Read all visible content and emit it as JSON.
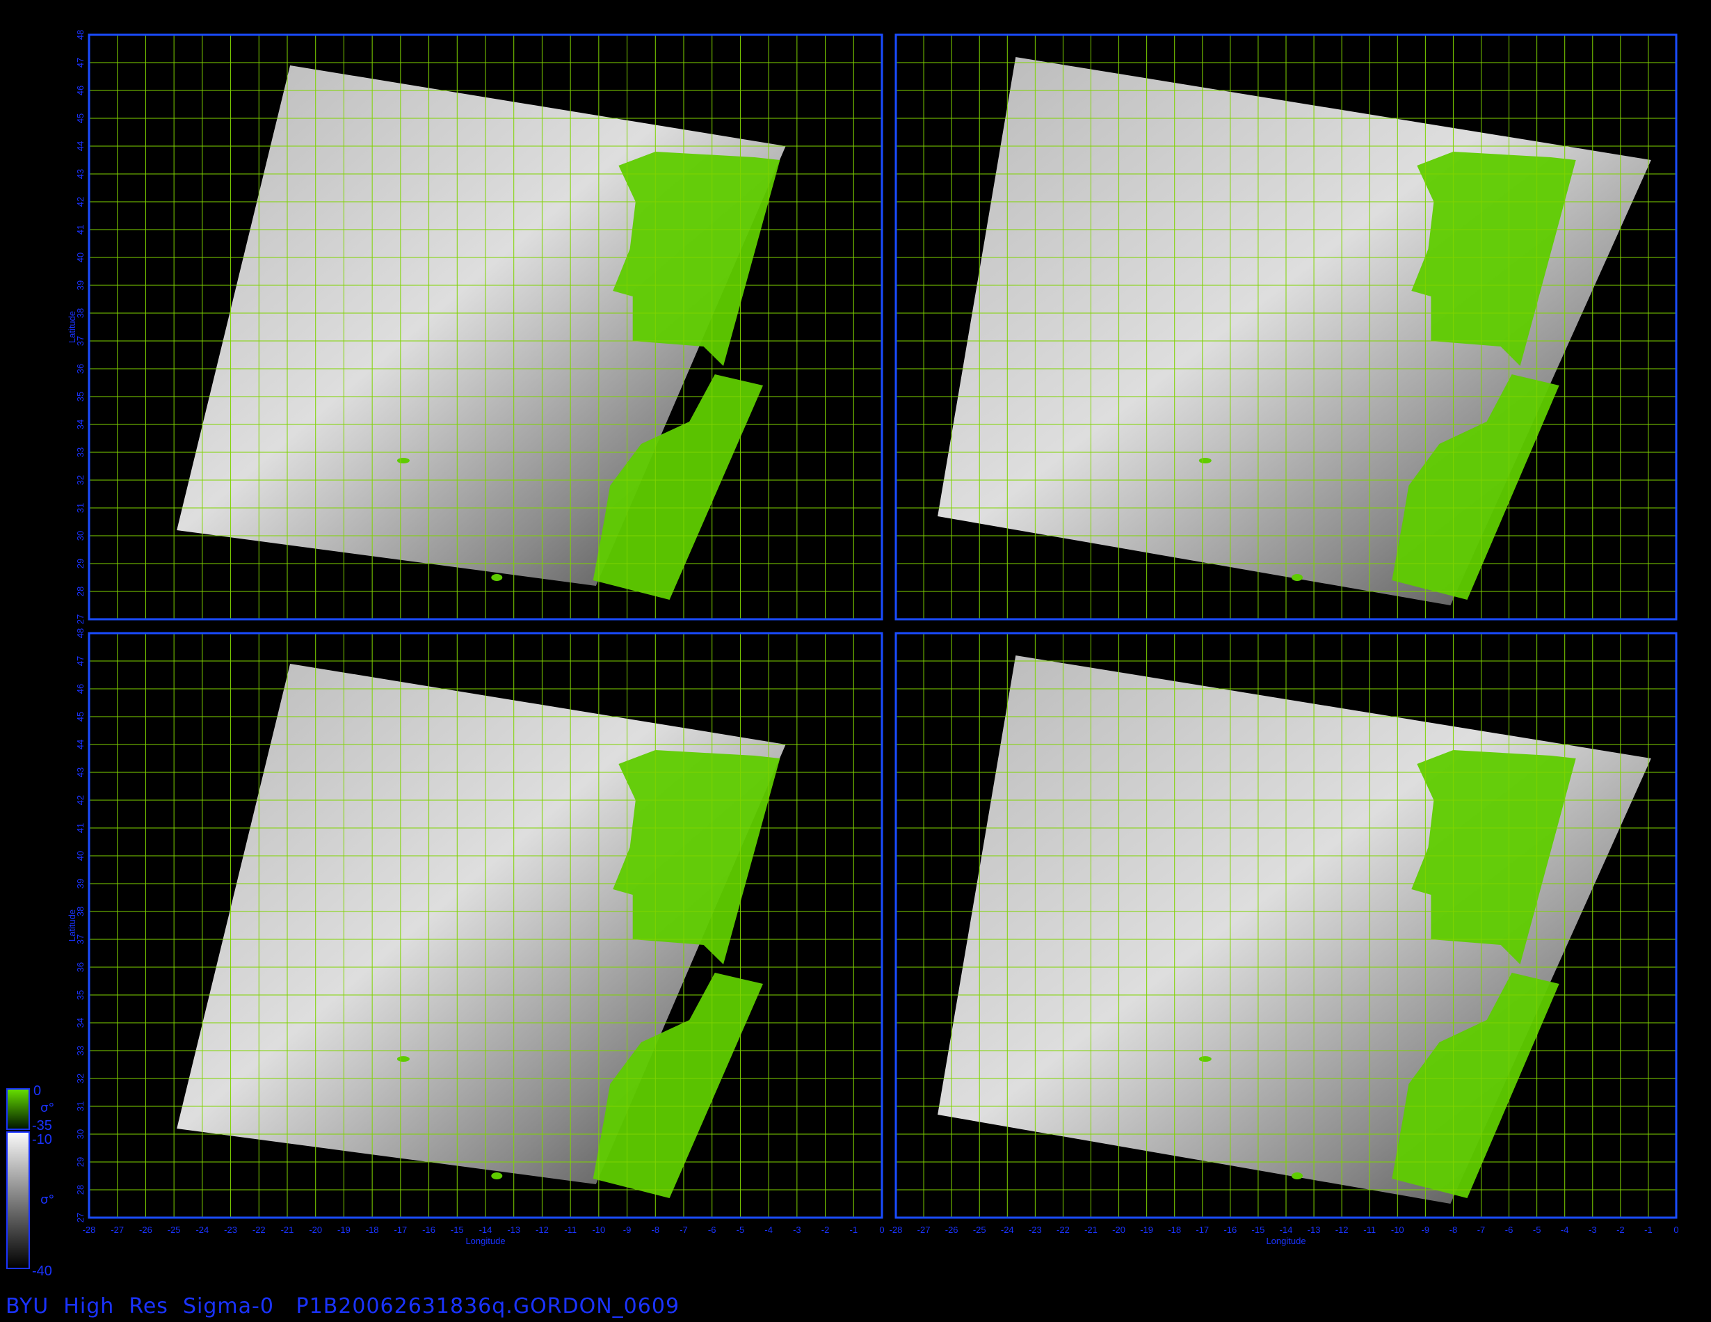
{
  "footer": {
    "title": "BYU  High  Res  Sigma-0   P1B20062631836q.GORDON_0609"
  },
  "axes": {
    "x_label": "Longitude",
    "y_label": "Latitude",
    "x_ticks": [
      "-28",
      "-27",
      "-26",
      "-25",
      "-24",
      "-23",
      "-22",
      "-21",
      "-20",
      "-19",
      "-18",
      "-17",
      "-16",
      "-15",
      "-14",
      "-13",
      "-12",
      "-11",
      "-10",
      "-9",
      "-8",
      "-7",
      "-6",
      "-5",
      "-4",
      "-3",
      "-2",
      "-1",
      "0"
    ],
    "y_ticks": [
      "27",
      "28",
      "29",
      "30",
      "31",
      "32",
      "33",
      "34",
      "35",
      "36",
      "37",
      "38",
      "39",
      "40",
      "41",
      "42",
      "43",
      "44",
      "45",
      "46",
      "47",
      "48"
    ],
    "x_range": [
      -28,
      0
    ],
    "y_range": [
      27,
      48
    ]
  },
  "colorbar": {
    "land_top": "0",
    "land_bottom": "-35",
    "ocean_top": "-10",
    "ocean_bottom": "-40",
    "land_symbol": "σ°",
    "ocean_symbol": "σ°"
  },
  "colors": {
    "background": "#000000",
    "frame": "#1a4cff",
    "grid": "#7fd400",
    "tick_text": "#1a33ff",
    "land": "#5fcc00"
  },
  "panels": [
    {
      "id": "top-left",
      "swath": [
        [
          -24.9,
          30.2
        ],
        [
          -20.9,
          46.9
        ],
        [
          -3.4,
          44.0
        ],
        [
          -10.1,
          28.2
        ]
      ]
    },
    {
      "id": "top-right",
      "swath": [
        [
          -26.5,
          30.7
        ],
        [
          -23.7,
          47.2
        ],
        [
          -0.9,
          43.5
        ],
        [
          -8.1,
          27.5
        ]
      ]
    },
    {
      "id": "bottom-left",
      "swath": [
        [
          -24.9,
          30.2
        ],
        [
          -20.9,
          46.9
        ],
        [
          -3.4,
          44.0
        ],
        [
          -10.1,
          28.2
        ]
      ]
    },
    {
      "id": "bottom-right",
      "swath": [
        [
          -26.5,
          30.7
        ],
        [
          -23.7,
          47.2
        ],
        [
          -0.9,
          43.5
        ],
        [
          -8.1,
          27.5
        ]
      ]
    }
  ]
}
